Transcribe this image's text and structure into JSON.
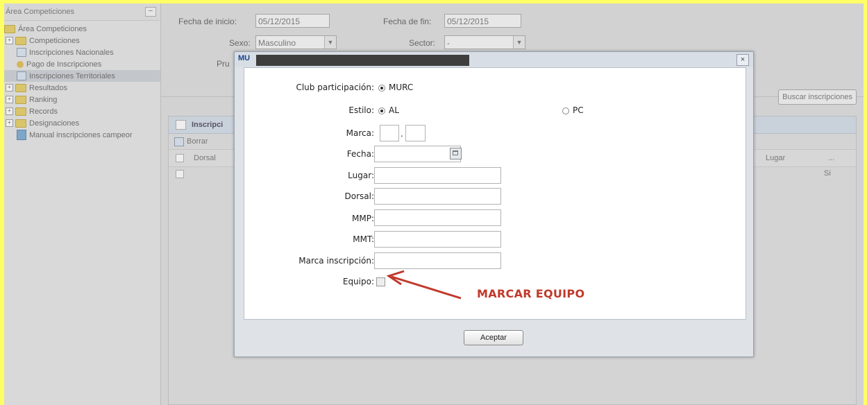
{
  "sidebar": {
    "header": "Área Competiciones",
    "collapse_glyph": "–",
    "items": [
      {
        "label": "Área Competiciones",
        "icon": "folder-icon",
        "toggle": ""
      },
      {
        "label": "Competiciones",
        "icon": "folder-icon",
        "toggle": "+"
      },
      {
        "label": "Inscripciones Nacionales",
        "icon": "document-icon",
        "toggle": ""
      },
      {
        "label": "Pago de Inscripciones",
        "icon": "coin-icon",
        "toggle": ""
      },
      {
        "label": "Inscripciones Territoriales",
        "icon": "document-icon",
        "toggle": "",
        "selected": true
      },
      {
        "label": "Resultados",
        "icon": "folder-icon",
        "toggle": "+"
      },
      {
        "label": "Ranking",
        "icon": "folder-icon",
        "toggle": "+"
      },
      {
        "label": "Records",
        "icon": "folder-icon",
        "toggle": "+"
      },
      {
        "label": "Designaciones",
        "icon": "folder-icon",
        "toggle": "+"
      },
      {
        "label": "Manual inscripciones campeor",
        "icon": "manual-icon",
        "toggle": ""
      }
    ]
  },
  "filters": {
    "fecha_inicio_label": "Fecha de inicio:",
    "fecha_inicio_value": "05/12/2015",
    "fecha_fin_label": "Fecha de fin:",
    "fecha_fin_value": "05/12/2015",
    "sexo_label": "Sexo:",
    "sexo_value": "Masculino",
    "sector_label": "Sector:",
    "sector_value": "-",
    "prueba_label": "Pru",
    "buscar_label": "Buscar inscripciones"
  },
  "grid": {
    "title": "Inscripci",
    "borrar_label": "Borrar",
    "columns": [
      "Dorsal",
      "Lugar",
      "..."
    ],
    "row_value": "Si"
  },
  "modal": {
    "title_code": "MU",
    "close_glyph": "×",
    "club_label": "Club participación:",
    "club_option": "MURC",
    "estilo_label": "Estilo:",
    "estilo_options": [
      "AL",
      "PC"
    ],
    "estilo_selected": "AL",
    "marca_label": "Marca:",
    "marca_separator": ".",
    "fecha_label": "Fecha:",
    "lugar_label": "Lugar:",
    "dorsal_label": "Dorsal:",
    "mmp_label": "MMP:",
    "mmt_label": "MMT:",
    "marca_inscripcion_label": "Marca inscripción:",
    "equipo_label": "Equipo:",
    "aceptar_label": "Aceptar"
  },
  "annotation": {
    "text": "MARCAR EQUIPO",
    "color": "#c0392b"
  },
  "colors": {
    "frame": "#ffff66",
    "title_text": "#15428b"
  }
}
